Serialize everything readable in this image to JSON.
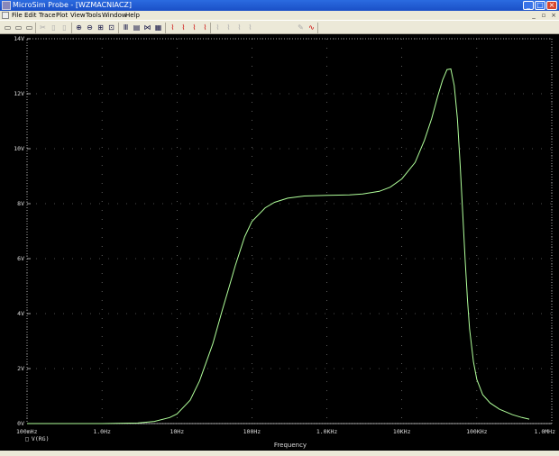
{
  "window": {
    "title": "MicroSim Probe - [WZMACNIACZ]",
    "buttons": {
      "minimize": "_",
      "maximize": "□",
      "close": "×"
    }
  },
  "menu": [
    "File",
    "Edit",
    "Trace",
    "Plot",
    "View",
    "Tools",
    "Window",
    "Help"
  ],
  "mdi_buttons": {
    "minimize": "_",
    "restore": "▫",
    "close": "×"
  },
  "toolbar": [
    {
      "name": "new-icon",
      "glyph": "▭"
    },
    {
      "name": "open-icon",
      "glyph": "▭"
    },
    {
      "name": "print-icon",
      "glyph": "▭"
    },
    {
      "name": "cut-icon",
      "glyph": "✂"
    },
    {
      "name": "copy-icon",
      "glyph": "▯"
    },
    {
      "name": "paste-icon",
      "glyph": "▯"
    },
    {
      "name": "zoom-in-icon",
      "glyph": "⊕"
    },
    {
      "name": "zoom-out-icon",
      "glyph": "⊖"
    },
    {
      "name": "zoom-area-icon",
      "glyph": "⊞"
    },
    {
      "name": "zoom-fit-icon",
      "glyph": "⊡"
    },
    {
      "name": "log-x-icon",
      "glyph": "Ⅲ"
    },
    {
      "name": "fft-icon",
      "glyph": "▤"
    },
    {
      "name": "performance-icon",
      "glyph": "⋈"
    },
    {
      "name": "add-trace-icon",
      "glyph": "▦"
    },
    {
      "name": "cursor-on-icon",
      "glyph": "⌇"
    },
    {
      "name": "cursor-peak-icon",
      "glyph": "⌇"
    },
    {
      "name": "cursor-trough-icon",
      "glyph": "⌇"
    },
    {
      "name": "cursor-slope-icon",
      "glyph": "⌇"
    },
    {
      "name": "cursor-min-icon",
      "glyph": "⌇"
    },
    {
      "name": "cursor-max-icon",
      "glyph": "⌇"
    },
    {
      "name": "cursor-point-icon",
      "glyph": "⌇"
    },
    {
      "name": "cursor-search-icon",
      "glyph": "⌇"
    },
    {
      "name": "mark-label-icon",
      "glyph": "✎"
    },
    {
      "name": "mark-data-icon",
      "glyph": "∿"
    }
  ],
  "colors": {
    "plot_background": "#000000",
    "trace": "#b0ff9a",
    "grid_dots": "#9a9a9a",
    "axis": "#cfcfcf",
    "title_bar": "#2b6be0"
  },
  "chart_data": {
    "type": "line",
    "x_scale": "log",
    "xlim_hz": [
      0.1,
      1000000
    ],
    "x_ticks": [
      "100mHz",
      "1.0Hz",
      "10Hz",
      "100Hz",
      "1.0KHz",
      "10KHz",
      "100KHz",
      "1.0MHz"
    ],
    "y_ticks": [
      "0V",
      "2V",
      "4V",
      "6V",
      "8V",
      "10V",
      "12V",
      "14V"
    ],
    "ylim": [
      0,
      14
    ],
    "xlabel": "Frequency",
    "legend": "V(RG)",
    "grid": "dotted",
    "series": [
      {
        "name": "V(RG)",
        "x_hz": [
          0.1,
          1,
          3,
          5,
          8,
          10,
          15,
          20,
          30,
          40,
          50,
          60,
          80,
          100,
          150,
          200,
          300,
          500,
          1000,
          2000,
          3000,
          5000,
          7000,
          10000,
          15000,
          20000,
          25000,
          30000,
          35000,
          40000,
          45000,
          50000,
          55000,
          60000,
          65000,
          70000,
          75000,
          80000,
          90000,
          100000,
          120000,
          150000,
          200000,
          300000,
          400000,
          500000
        ],
        "y_v": [
          0,
          0,
          0.02,
          0.08,
          0.22,
          0.35,
          0.85,
          1.55,
          2.9,
          4.1,
          5.0,
          5.75,
          6.8,
          7.35,
          7.85,
          8.05,
          8.2,
          8.28,
          8.3,
          8.32,
          8.35,
          8.45,
          8.6,
          8.9,
          9.5,
          10.3,
          11.1,
          11.9,
          12.5,
          12.88,
          12.9,
          12.3,
          11.1,
          9.4,
          7.6,
          5.9,
          4.5,
          3.45,
          2.25,
          1.6,
          1.05,
          0.75,
          0.52,
          0.32,
          0.22,
          0.16
        ]
      }
    ]
  }
}
